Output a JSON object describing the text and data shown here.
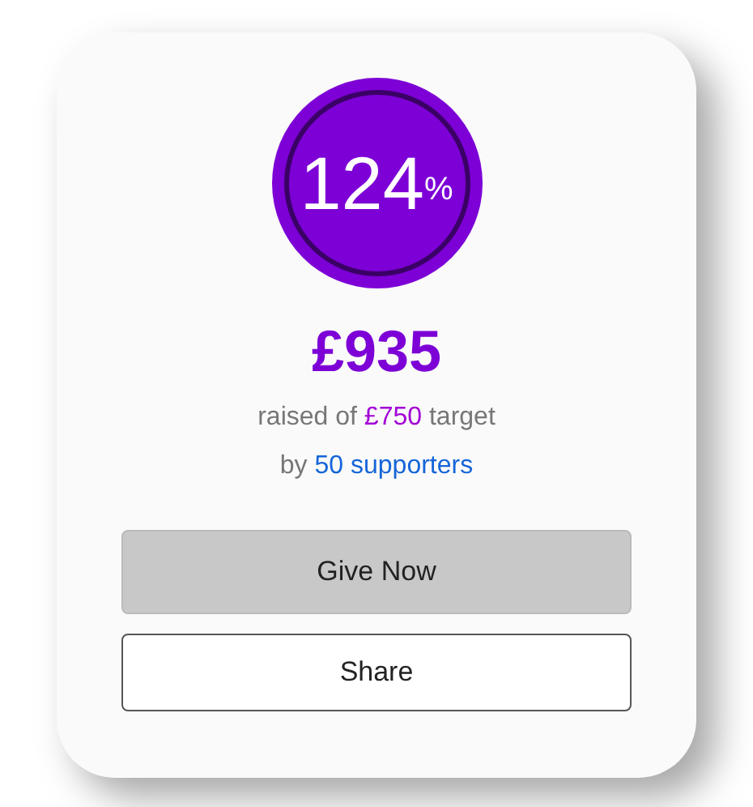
{
  "progress": {
    "percent": "124",
    "unit": "%",
    "level": 1
  },
  "raised": {
    "amount": "£935",
    "line1": {
      "prefix": "raised of",
      "target": "£750",
      "suffix": "target"
    },
    "line2": {
      "prefix": "by",
      "supporters": "50 supporters"
    }
  },
  "buttons": [
    {
      "label": "Give Now",
      "kind": "primary"
    },
    {
      "label": "Share",
      "kind": "outline"
    }
  ]
}
